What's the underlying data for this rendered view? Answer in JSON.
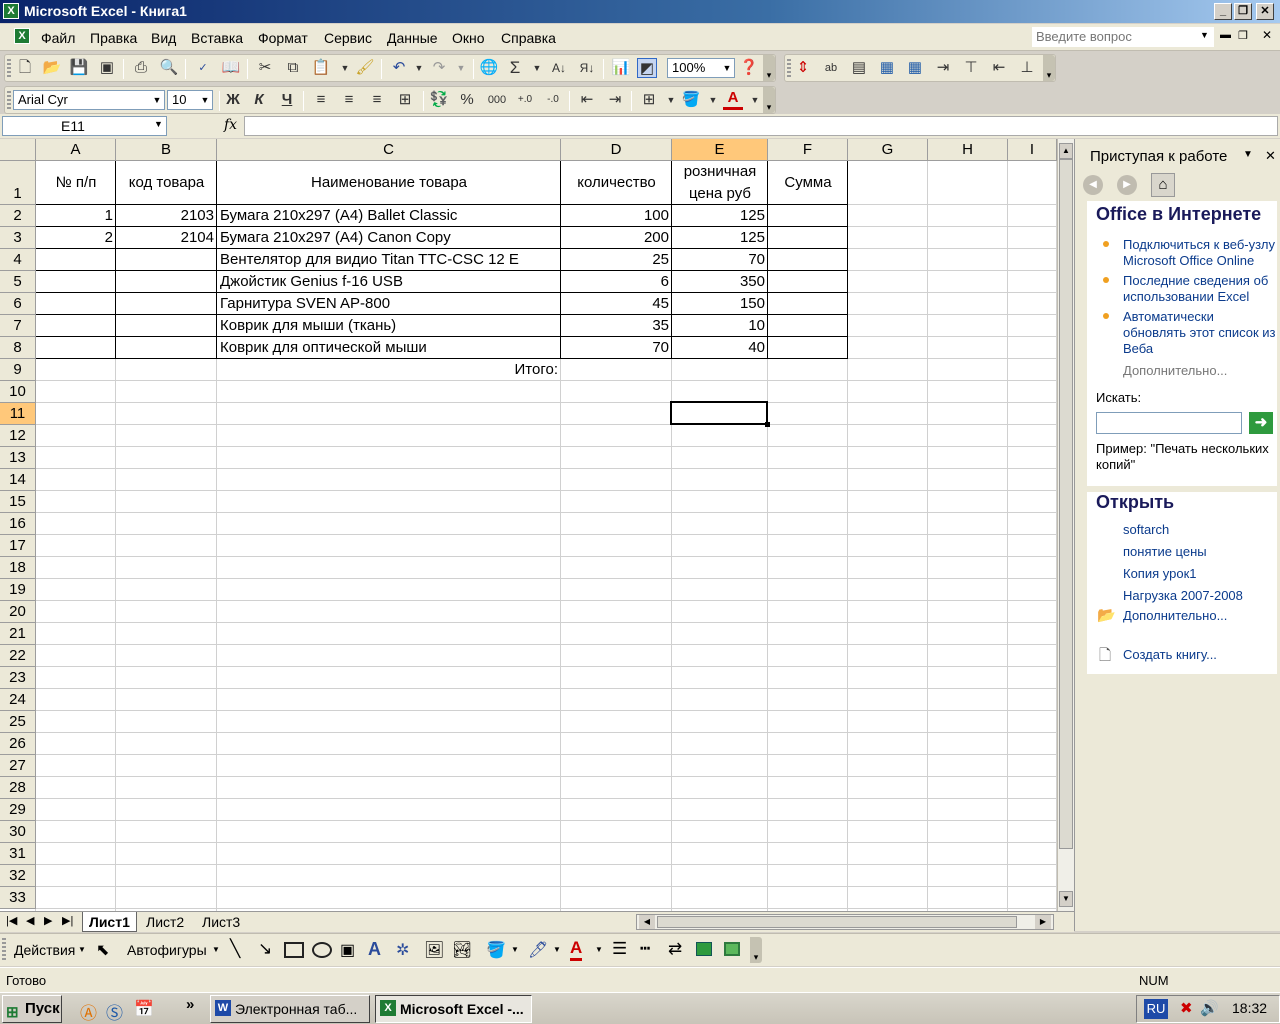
{
  "window": {
    "title": "Microsoft Excel - Книга1"
  },
  "menu": [
    "Файл",
    "Правка",
    "Вид",
    "Вставка",
    "Формат",
    "Сервис",
    "Данные",
    "Окно",
    "Справка"
  ],
  "question_placeholder": "Введите вопрос",
  "toolbar": {
    "zoom": "100%",
    "font": "Arial Cyr",
    "size": "10",
    "bold": "Ж",
    "italic": "К",
    "underline": "Ч",
    "percent": "%",
    "thousands": "000"
  },
  "formula_bar": {
    "namebox": "E11",
    "fx": "fx",
    "value": ""
  },
  "columns": [
    "A",
    "B",
    "C",
    "D",
    "E",
    "F",
    "G",
    "H",
    "I"
  ],
  "rows": [
    "1",
    "2",
    "3",
    "4",
    "5",
    "6",
    "7",
    "8",
    "9",
    "10",
    "11",
    "12",
    "13",
    "14",
    "15",
    "16",
    "17",
    "18",
    "19",
    "20",
    "21",
    "22",
    "23",
    "24",
    "25",
    "26",
    "27",
    "28",
    "29",
    "30",
    "31",
    "32",
    "33"
  ],
  "table": {
    "headers": {
      "A": "№ п/п",
      "B": "код товара",
      "C": "Наименование товара",
      "D": "количество",
      "E1": "розничная",
      "E2": "цена руб",
      "F": "Сумма"
    },
    "rows": [
      {
        "n": "1",
        "code": "2103",
        "name": "Бумага 210x297 (A4) Ballet Classic",
        "qty": "100",
        "price": "125"
      },
      {
        "n": "2",
        "code": "2104",
        "name": "Бумага 210x297 (A4) Canon Copy",
        "qty": "200",
        "price": "125"
      },
      {
        "n": "",
        "code": "",
        "name": "Вентелятор для видио Titan TTC-CSC 12 E",
        "qty": "25",
        "price": "70"
      },
      {
        "n": "",
        "code": "",
        "name": "Джойстик Genius f-16 USB",
        "qty": "6",
        "price": "350"
      },
      {
        "n": "",
        "code": "",
        "name": "Гарнитура SVEN AP-800",
        "qty": "45",
        "price": "150"
      },
      {
        "n": "",
        "code": "",
        "name": "Коврик для мыши (ткань)",
        "qty": "35",
        "price": "10"
      },
      {
        "n": "",
        "code": "",
        "name": "Коврик для оптической мыши",
        "qty": "70",
        "price": "40"
      }
    ],
    "total_label": "Итого:"
  },
  "sheets": [
    "Лист1",
    "Лист2",
    "Лист3"
  ],
  "taskpane": {
    "title": "Приступая к работе",
    "online_heading": "Office в Интернете",
    "links": [
      "Подключиться к веб-узлу Microsoft Office Online",
      "Последние сведения об использовании Excel",
      "Автоматически обновлять этот список из Веба"
    ],
    "more": "Дополнительно...",
    "search_label": "Искать:",
    "example": "Пример:  \"Печать нескольких копий\"",
    "open_heading": "Открыть",
    "files": [
      "softarch",
      "понятие цены",
      "Копия урок1",
      "Нагрузка 2007-2008"
    ],
    "open_more": "Дополнительно...",
    "create": "Создать книгу..."
  },
  "drawbar": {
    "actions": "Действия",
    "autoshapes": "Автофигуры"
  },
  "status": {
    "ready": "Готово",
    "num": "NUM"
  },
  "taskbar": {
    "start": "Пуск",
    "tasks": [
      "Электронная таб...",
      "Microsoft Excel -..."
    ],
    "lang": "RU",
    "time": "18:32"
  }
}
